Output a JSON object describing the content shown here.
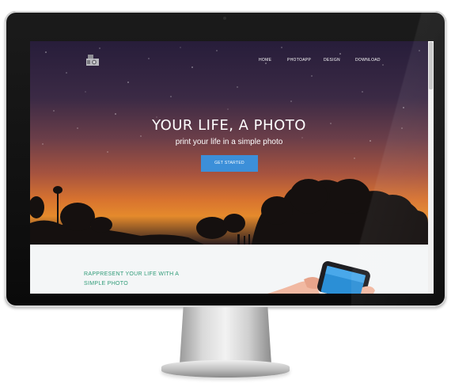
{
  "header": {
    "nav_items": [
      {
        "label": "HOME"
      },
      {
        "label": "PHOTOAPP"
      },
      {
        "label": "DESIGN"
      },
      {
        "label": "DOWNLOAD"
      }
    ]
  },
  "hero": {
    "title": "YOUR LIFE, A PHOTO",
    "subtitle": "print your life in a simple photo",
    "button_label": "GET STARTED"
  },
  "section": {
    "tagline_line1": "RAPPRESENT YOUR LIFE WITH A",
    "tagline_line2": "SIMPLE PHOTO"
  },
  "colors": {
    "accent_button": "#3c8fd9",
    "tagline": "#2f9b78"
  },
  "icons": {
    "logo": "camera-stack-icon"
  }
}
